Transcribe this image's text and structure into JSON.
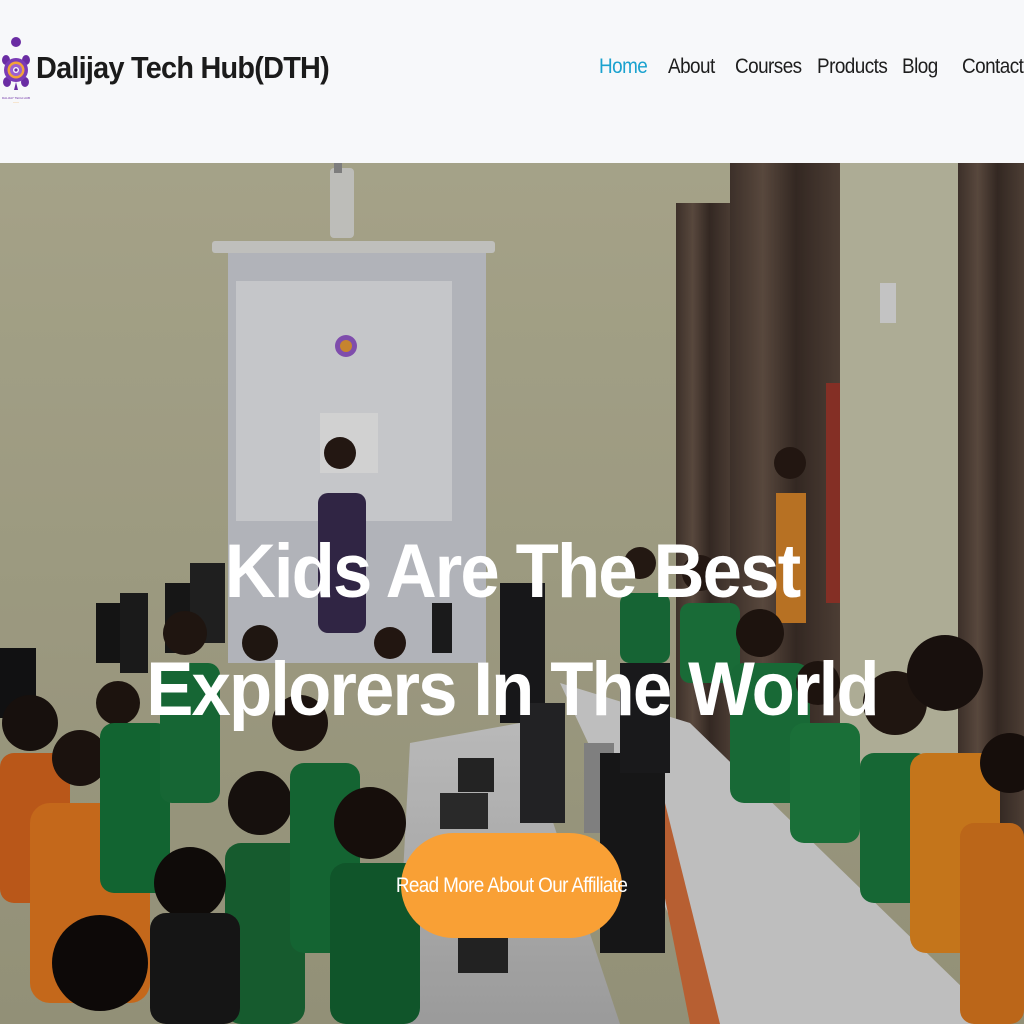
{
  "header": {
    "brand": {
      "name": "Dalijay Tech Hub(DTH)",
      "logo_icon": "turtle-logo-icon",
      "logo_caption": "DALIJAY TECH HUB"
    },
    "nav": [
      {
        "label": "Home",
        "active": true
      },
      {
        "label": "About",
        "active": false
      },
      {
        "label": "Courses",
        "active": false
      },
      {
        "label": "Products",
        "active": false
      },
      {
        "label": "Blog",
        "active": false
      },
      {
        "label": "Contact",
        "active": false
      }
    ]
  },
  "hero": {
    "title_line1": "Kids Are The Best",
    "title_line2": "Explorers In The World",
    "cta_label": "Read More About Our Affiliate",
    "background": "classroom-photo"
  },
  "colors": {
    "nav_active": "#1aa2cf",
    "cta": "#f9a035",
    "logo_purple": "#6a2ca3"
  }
}
